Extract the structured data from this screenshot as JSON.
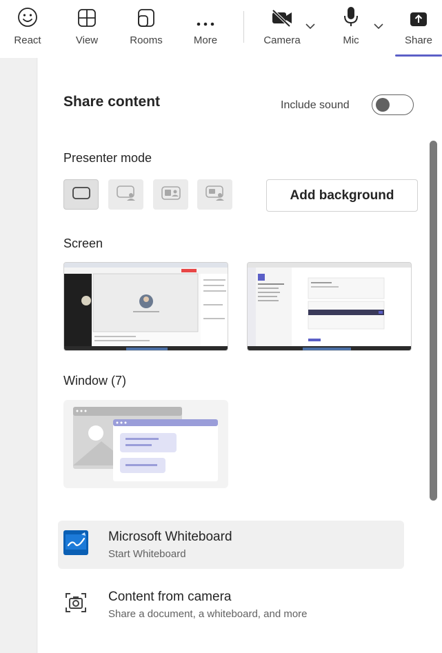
{
  "toolbar": {
    "react_label": "React",
    "view_label": "View",
    "rooms_label": "Rooms",
    "more_label": "More",
    "camera_label": "Camera",
    "mic_label": "Mic",
    "share_label": "Share",
    "icons": [
      "smiley-icon",
      "grid-icon",
      "rooms-icon",
      "ellipsis-icon",
      "camera-off-icon",
      "microphone-icon",
      "share-upload-icon"
    ],
    "accent_color": "#5b5fc7"
  },
  "panel": {
    "title": "Share content",
    "include_sound_label": "Include sound",
    "include_sound_on": false,
    "presenter_mode_label": "Presenter mode",
    "presenter_modes": [
      "content-only",
      "standout",
      "side-by-side",
      "reporter"
    ],
    "add_background_label": "Add background",
    "screen_label": "Screen",
    "window_label": "Window (7)",
    "options": [
      {
        "title": "Microsoft Whiteboard",
        "subtitle": "Start Whiteboard",
        "icon": "whiteboard-icon"
      },
      {
        "title": "Content from camera",
        "subtitle": "Share a document, a whiteboard, and more",
        "icon": "camera-scan-icon"
      }
    ]
  }
}
